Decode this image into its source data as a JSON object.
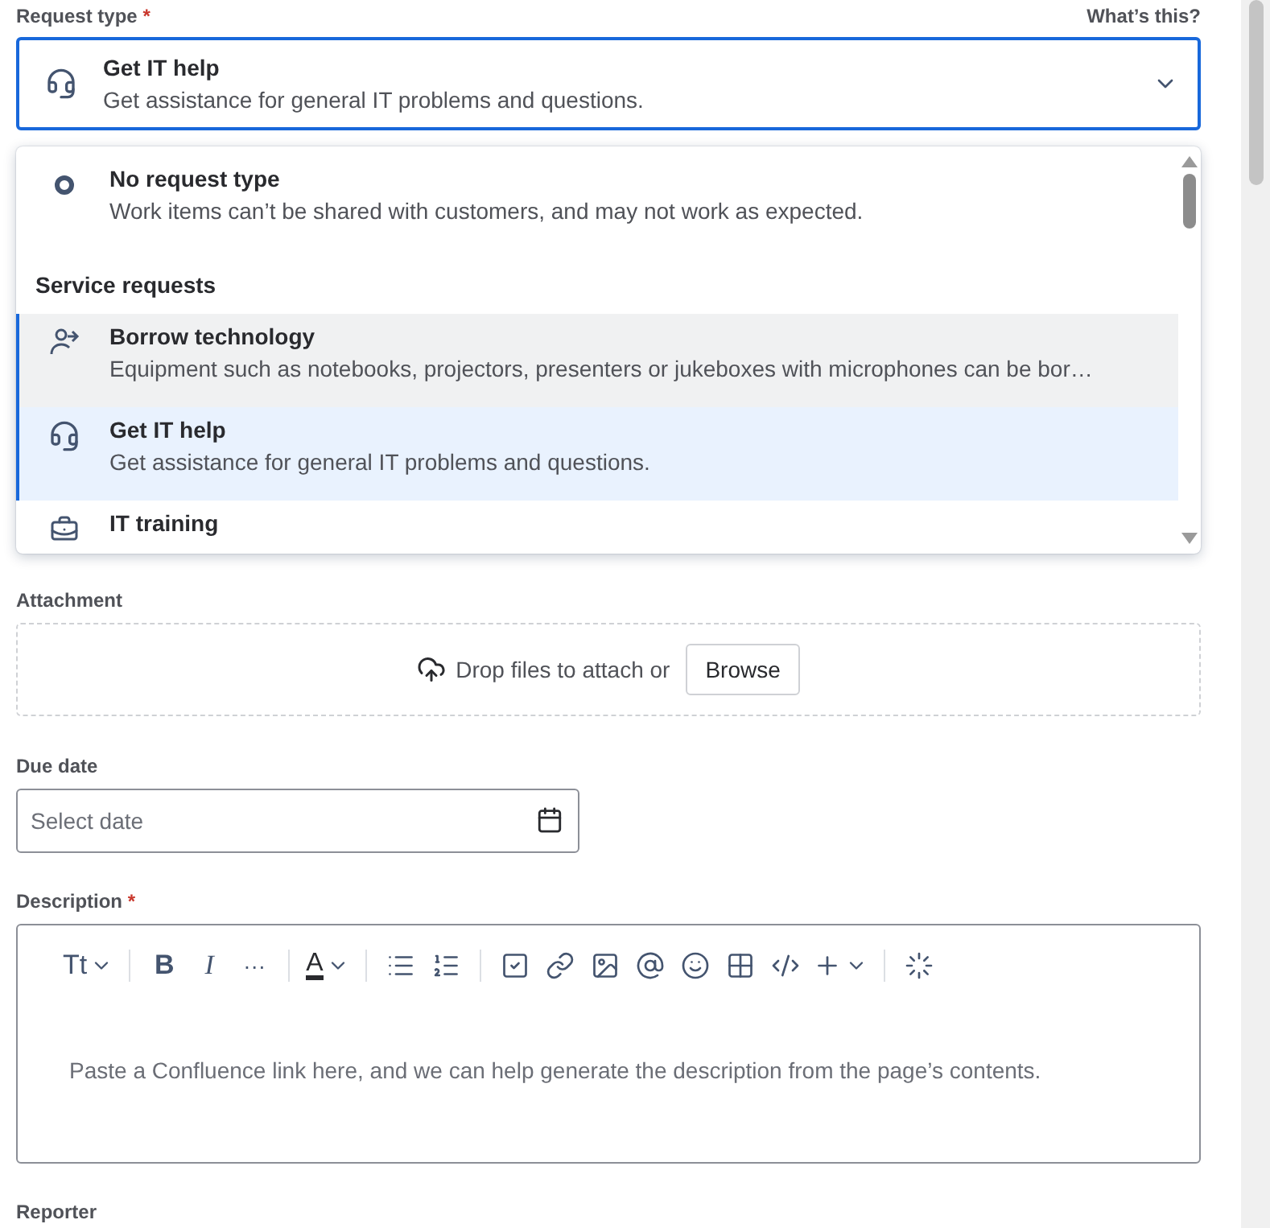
{
  "request_type": {
    "label": "Request type",
    "required_mark": "*",
    "help_link": "What’s this?",
    "value_title": "Get IT help",
    "value_description": "Get assistance for general IT problems and questions.",
    "expanded": true
  },
  "options": [
    {
      "kind": "option",
      "title": "No request type",
      "description": "Work items can’t be shared with customers, and may not work as expected.",
      "selected": false,
      "hovered": false
    },
    {
      "kind": "heading",
      "label": "Service requests"
    },
    {
      "kind": "option",
      "title": "Borrow technology",
      "description": "Equipment such as notebooks, projectors, presenters or jukeboxes with microphones can be bor…",
      "selected": false,
      "hovered": true
    },
    {
      "kind": "option",
      "title": "Get IT help",
      "description": "Get assistance for general IT problems and questions.",
      "selected": true,
      "hovered": false
    },
    {
      "kind": "option",
      "title": "IT training",
      "selected": false,
      "hovered": false
    }
  ],
  "attachment": {
    "label": "Attachment",
    "drop_text": "Drop files to attach or",
    "browse": "Browse"
  },
  "due_date": {
    "label": "Due date",
    "placeholder": "Select date"
  },
  "description": {
    "label": "Description",
    "required_mark": "*",
    "placeholder": "Paste a Confluence link here, and we can help generate the description from the page’s contents.",
    "toolbar": {
      "text_style": "Tt",
      "bold": "B",
      "italic": "I",
      "more": "···",
      "text_color": "A"
    }
  },
  "reporter": {
    "label": "Reporter"
  }
}
